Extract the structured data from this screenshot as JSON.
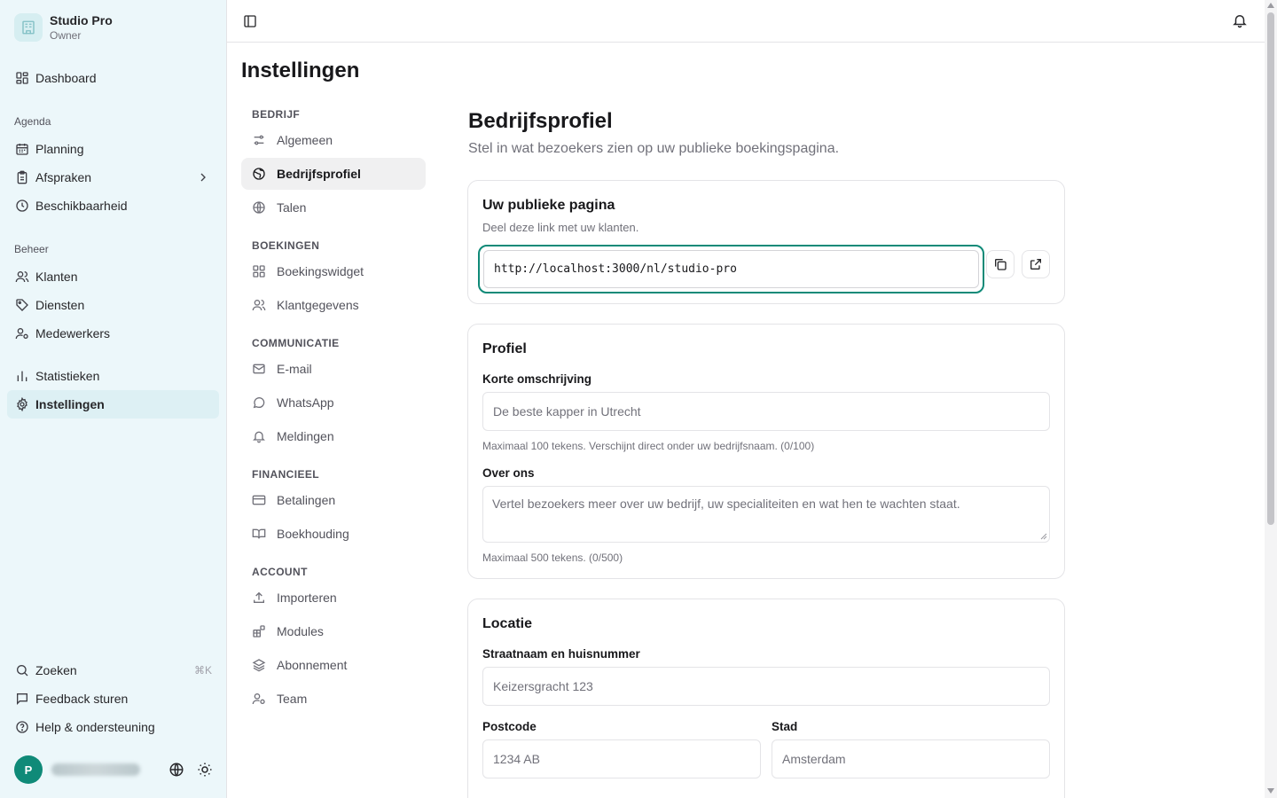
{
  "brand": {
    "name": "Studio Pro",
    "role": "Owner"
  },
  "sidebar": {
    "dashboard": "Dashboard",
    "groups": {
      "agenda": "Agenda",
      "beheer": "Beheer"
    },
    "items": {
      "planning": "Planning",
      "afspraken": "Afspraken",
      "beschikbaarheid": "Beschikbaarheid",
      "klanten": "Klanten",
      "diensten": "Diensten",
      "medewerkers": "Medewerkers",
      "statistieken": "Statistieken",
      "instellingen": "Instellingen"
    },
    "footer": {
      "zoeken": "Zoeken",
      "shortcut": "⌘K",
      "feedback": "Feedback sturen",
      "help": "Help & ondersteuning"
    },
    "user": {
      "initial": "P"
    }
  },
  "page": {
    "title": "Instellingen"
  },
  "settings_nav": {
    "sections": {
      "bedrijf": "BEDRIJF",
      "boekingen": "BOEKINGEN",
      "communicatie": "COMMUNICATIE",
      "financieel": "FINANCIEEL",
      "account": "ACCOUNT"
    },
    "items": {
      "algemeen": "Algemeen",
      "bedrijfsprofiel": "Bedrijfsprofiel",
      "talen": "Talen",
      "boekingswidget": "Boekingswidget",
      "klantgegevens": "Klantgegevens",
      "email": "E-mail",
      "whatsapp": "WhatsApp",
      "meldingen": "Meldingen",
      "betalingen": "Betalingen",
      "boekhouding": "Boekhouding",
      "importeren": "Importeren",
      "modules": "Modules",
      "abonnement": "Abonnement",
      "team": "Team"
    }
  },
  "content": {
    "title": "Bedrijfsprofiel",
    "subtitle": "Stel in wat bezoekers zien op uw publieke boekingspagina.",
    "public_page": {
      "title": "Uw publieke pagina",
      "description": "Deel deze link met uw klanten.",
      "url": "http://localhost:3000/nl/studio-pro"
    },
    "profile": {
      "title": "Profiel",
      "short_label": "Korte omschrijving",
      "short_placeholder": "De beste kapper in Utrecht",
      "short_hint": "Maximaal 100 tekens. Verschijnt direct onder uw bedrijfsnaam. (0/100)",
      "about_label": "Over ons",
      "about_placeholder": "Vertel bezoekers meer over uw bedrijf, uw specialiteiten en wat hen te wachten staat.",
      "about_hint": "Maximaal 500 tekens. (0/500)"
    },
    "location": {
      "title": "Locatie",
      "street_label": "Straatnaam en huisnummer",
      "street_placeholder": "Keizersgracht 123",
      "postcode_label": "Postcode",
      "postcode_placeholder": "1234 AB",
      "city_label": "Stad",
      "city_placeholder": "Amsterdam"
    }
  },
  "icons": {
    "brand": "building-icon",
    "sidebar_toggle": "sidebar-toggle-icon",
    "notifications": "bell-icon",
    "copy": "copy-icon",
    "open_external": "external-link-icon"
  },
  "colors": {
    "accent": "#0f8a78",
    "sidebar_bg": "#ecf7fa"
  }
}
